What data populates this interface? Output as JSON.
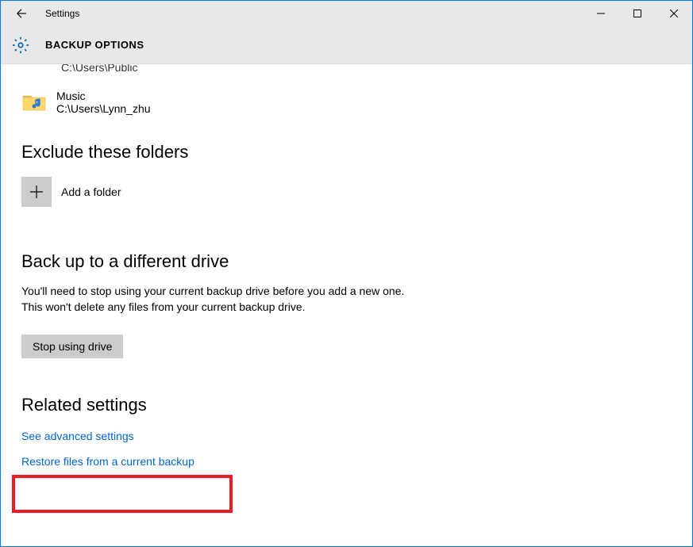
{
  "window": {
    "title": "Settings"
  },
  "header": {
    "title": "BACKUP OPTIONS"
  },
  "partial_folder_path": "C:\\Users\\Public",
  "folder_item": {
    "label": "Music",
    "path": "C:\\Users\\Lynn_zhu"
  },
  "exclude": {
    "heading": "Exclude these folders",
    "add_label": "Add a folder"
  },
  "different_drive": {
    "heading": "Back up to a different drive",
    "description": "You'll need to stop using your current backup drive before you add a new one. This won't delete any files from your current backup drive.",
    "button": "Stop using drive"
  },
  "related": {
    "heading": "Related settings",
    "link1": "See advanced settings",
    "link2": "Restore files from a current backup"
  }
}
